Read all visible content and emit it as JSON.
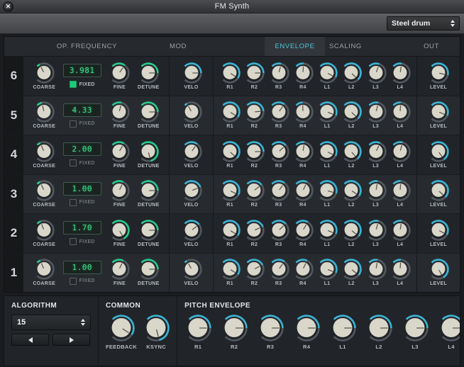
{
  "window": {
    "title": "FM Synth",
    "close_icon": "close-icon"
  },
  "preset": {
    "name": "Steel drum",
    "spinner_icon": "up-down-spinner-icon"
  },
  "tabs": [
    {
      "id": "opfreq",
      "label": "OP. FREQUENCY",
      "active": false
    },
    {
      "id": "mod",
      "label": "MOD",
      "active": false
    },
    {
      "id": "env",
      "label": "ENVELOPE",
      "active": true
    },
    {
      "id": "scaling",
      "label": "SCALING",
      "active": false
    },
    {
      "id": "out",
      "label": "OUT",
      "active": false
    }
  ],
  "colors": {
    "accent_cyan": "#3ab3d4",
    "accent_green": "#27c98a",
    "led_green": "#39e08a",
    "knob_cap": "#d6d2c6",
    "panel_bg": "#212428",
    "row_alt_bg": "#272b2f"
  },
  "labels": {
    "coarse": "COARSE",
    "fixed": "FIXED",
    "fine": "FINE",
    "detune": "DETUNE",
    "velo": "VELO",
    "level": "LEVEL",
    "env": [
      "R1",
      "R2",
      "R3",
      "R4",
      "L1",
      "L2",
      "L3",
      "L4"
    ]
  },
  "operators": [
    {
      "number": "6",
      "freq_display": "3.981",
      "fixed": true,
      "coarse": 0.07,
      "fine": 0.3,
      "detune": 0.5,
      "velo": 0.5,
      "env": [
        0.62,
        0.5,
        0.22,
        0.18,
        0.6,
        0.66,
        0.24,
        0.2
      ],
      "level": 0.55
    },
    {
      "number": "5",
      "freq_display": "4.33",
      "fixed": false,
      "coarse": 0.12,
      "fine": 0.22,
      "detune": 0.5,
      "velo": 0.06,
      "env": [
        0.62,
        0.48,
        0.3,
        0.16,
        0.58,
        0.66,
        0.22,
        0.18
      ],
      "level": 0.58
    },
    {
      "number": "4",
      "freq_display": "2.00",
      "fixed": false,
      "coarse": 0.08,
      "fine": 0.28,
      "detune": 0.78,
      "velo": 0.3,
      "env": [
        0.66,
        0.5,
        0.34,
        0.2,
        0.6,
        0.68,
        0.26,
        0.22
      ],
      "level": 0.7
    },
    {
      "number": "3",
      "freq_display": "1.00",
      "fixed": false,
      "coarse": 0.08,
      "fine": 0.26,
      "detune": 0.5,
      "velo": 0.42,
      "env": [
        0.6,
        0.36,
        0.3,
        0.26,
        0.56,
        0.62,
        0.2,
        0.18
      ],
      "level": 0.66
    },
    {
      "number": "2",
      "freq_display": "1.70",
      "fixed": false,
      "coarse": 0.09,
      "fine": 0.72,
      "detune": 0.5,
      "velo": 0.36,
      "env": [
        0.62,
        0.42,
        0.34,
        0.28,
        0.58,
        0.64,
        0.22,
        0.2
      ],
      "level": 0.6
    },
    {
      "number": "1",
      "freq_display": "1.00",
      "fixed": false,
      "coarse": 0.08,
      "fine": 0.26,
      "detune": 0.5,
      "velo": 0.06,
      "env": [
        0.62,
        0.4,
        0.3,
        0.26,
        0.58,
        0.64,
        0.2,
        0.18
      ],
      "level": 0.72
    }
  ],
  "algorithm": {
    "title": "ALGORITHM",
    "value": "15",
    "spinner_icon": "up-down-spinner-icon",
    "prev_icon": "triangle-left-icon",
    "next_icon": "triangle-right-icon"
  },
  "common": {
    "title": "COMMON",
    "knobs": [
      {
        "label": "FEEDBACK",
        "value": 0.62
      },
      {
        "label": "KSYNC",
        "value": 0.78
      }
    ]
  },
  "pitch_envelope": {
    "title": "PITCH ENVELOPE",
    "knobs": [
      {
        "label": "R1",
        "value": 0.5
      },
      {
        "label": "R2",
        "value": 0.5
      },
      {
        "label": "R3",
        "value": 0.5
      },
      {
        "label": "R4",
        "value": 0.5
      },
      {
        "label": "L1",
        "value": 0.5
      },
      {
        "label": "L2",
        "value": 0.5
      },
      {
        "label": "L3",
        "value": 0.5
      },
      {
        "label": "L4",
        "value": 0.5
      }
    ]
  }
}
